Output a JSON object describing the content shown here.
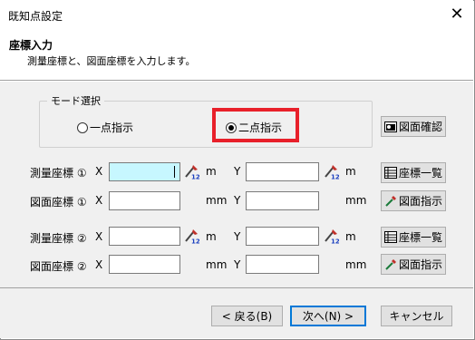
{
  "window": {
    "title": "既知点設定",
    "close_glyph": "✕"
  },
  "header": {
    "title": "座標入力",
    "description": "測量座標と、図面座標を入力します。"
  },
  "mode_group": {
    "legend": "モード選択",
    "options": [
      {
        "label": "一点指示",
        "selected": false
      },
      {
        "label": "二点指示",
        "selected": true
      }
    ],
    "highlight_color": "#e8202a"
  },
  "buttons": {
    "drawing_check": "図面確認",
    "coord_list": "座標一覧",
    "drawing_pick": "図面指示"
  },
  "rows": [
    {
      "label": "測量座標 ①",
      "x_label": "X",
      "y_label": "Y",
      "unit": "m",
      "x_value": "",
      "y_value": ""
    },
    {
      "label": "図面座標 ①",
      "x_label": "X",
      "y_label": "Y",
      "unit": "mm",
      "x_value": "",
      "y_value": ""
    },
    {
      "label": "測量座標 ②",
      "x_label": "X",
      "y_label": "Y",
      "unit": "m",
      "x_value": "",
      "y_value": ""
    },
    {
      "label": "図面座標 ②",
      "x_label": "X",
      "y_label": "Y",
      "unit": "mm",
      "x_value": "",
      "y_value": ""
    }
  ],
  "icons": {
    "calc": "calculator-123-icon",
    "pick": "eyedropper-icon",
    "list": "list-icon",
    "check": "drawing-icon"
  },
  "calc_text": "123",
  "footer": {
    "back": "< 戻る(B)",
    "next": "次へ(N) >",
    "cancel": "キャンセル"
  }
}
